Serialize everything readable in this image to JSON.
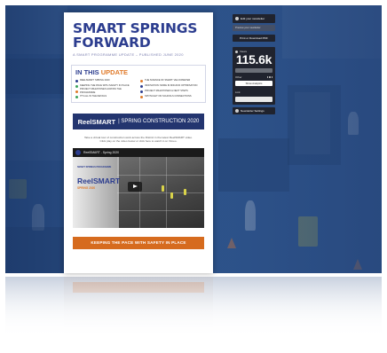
{
  "newsletter": {
    "title_line1": "SMART SPRINGS",
    "title_line2": "FORWARD",
    "subtitle": "A SMART PROGRAMME UPDATE – PUBLISHED JUNE 2020",
    "toc": {
      "heading_prefix": "IN THIS",
      "heading_accent": "UPDATE",
      "items": [
        {
          "label": "REELSMART: SPRING 2020",
          "color": "#2c3d8f"
        },
        {
          "label": "THE SCIENCE OF SMART: VELOCIMETER",
          "color": "#e07a2a"
        },
        {
          "label": "KEEPING THE PACE WITH SAFETY IN PLACE",
          "color": "#3aa35b"
        },
        {
          "label": "INNOVATION: MORE IN MID-RUN OPTIMISATION",
          "color": "#2c3d8f"
        },
        {
          "label": "PROJECT MILESTONES ACROSS THE PROGRAMME",
          "color": "#e07a2a"
        },
        {
          "label": "PROJECT MILESTONES & NEXT STEPS",
          "color": "#2c3d8f"
        },
        {
          "label": "IT'S ALL IN THE DETAILS",
          "color": "#3aa35b"
        },
        {
          "label": "SPOTLIGHT ON SCHOOLS CONNECTIONS",
          "color": "#e07a2a"
        }
      ]
    },
    "banner_logo": "ReelSMART",
    "banner_text": "| SPRING CONSTRUCTION 2020",
    "intro_line1": "Take a virtual tour of construction work across the District in the latest ReelSMART video.",
    "intro_line2": "Click play on the video below or click here to watch it on Vimeo.",
    "video": {
      "title": "ReelSMART - Spring 2020",
      "brand": "SMART SPRINGS PROGRAMME",
      "name": "ReelSMART",
      "sub": "SPRING 2020"
    },
    "cta": "KEEPING THE PACE WITH SAFETY IN PLACE"
  },
  "panel": {
    "edit_label": "Edit your newsletter",
    "preview_label": "Preview your newsletter",
    "pdf_label": "Print or Download PDF",
    "views_label": "Views",
    "views_value": "115.6k",
    "other_label": "Other",
    "show_analytics": "Show Analytics",
    "link_label": "Link",
    "settings_label": "Newsletter Settings"
  },
  "colors": {
    "brand_blue": "#2c3d8f",
    "accent_orange": "#d66b1e",
    "panel_dark": "#202026"
  }
}
